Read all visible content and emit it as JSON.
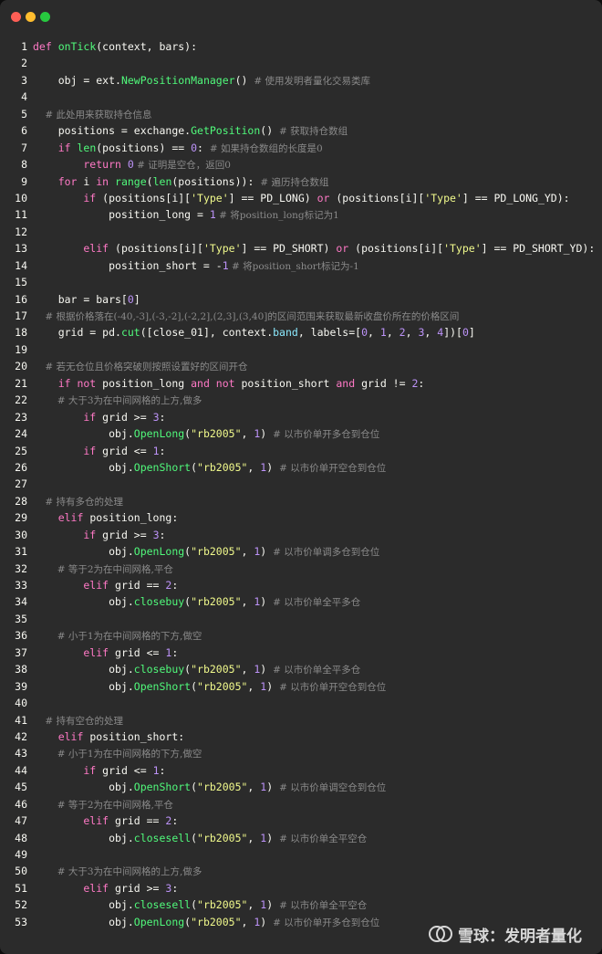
{
  "window": {
    "traffic_lights": [
      "close",
      "minimize",
      "zoom"
    ]
  },
  "code_lines": [
    {
      "n": "1",
      "tokens": [
        [
          "kw",
          "def "
        ],
        [
          "fn",
          "onTick"
        ],
        [
          "",
          "(context, bars):"
        ]
      ]
    },
    {
      "n": "2",
      "tokens": []
    },
    {
      "n": "3",
      "tokens": [
        [
          "",
          "    obj = ext."
        ],
        [
          "fn",
          "NewPositionManager"
        ],
        [
          "",
          "() "
        ],
        [
          "cm",
          "# 使用发明者量化交易类库"
        ]
      ]
    },
    {
      "n": "4",
      "tokens": []
    },
    {
      "n": "5",
      "tokens": [
        [
          "cm",
          "    # 此处用来获取持仓信息"
        ]
      ]
    },
    {
      "n": "6",
      "tokens": [
        [
          "",
          "    positions = exchange."
        ],
        [
          "fn",
          "GetPosition"
        ],
        [
          "",
          "() "
        ],
        [
          "cm",
          "# 获取持仓数组"
        ]
      ]
    },
    {
      "n": "7",
      "tokens": [
        [
          "kw",
          "    if "
        ],
        [
          "fn",
          "len"
        ],
        [
          "",
          "(positions) == "
        ],
        [
          "num",
          "0"
        ],
        [
          "",
          ": "
        ],
        [
          "cm",
          "# 如果持仓数组的长度是0"
        ]
      ]
    },
    {
      "n": "8",
      "tokens": [
        [
          "kw",
          "        return "
        ],
        [
          "num",
          "0"
        ],
        [
          "cm",
          " # 证明是空仓，返回0"
        ]
      ]
    },
    {
      "n": "9",
      "tokens": [
        [
          "kw",
          "    for "
        ],
        [
          "",
          "i "
        ],
        [
          "kw",
          "in "
        ],
        [
          "fn",
          "range"
        ],
        [
          "",
          "("
        ],
        [
          "fn",
          "len"
        ],
        [
          "",
          "(positions)): "
        ],
        [
          "cm",
          "# 遍历持仓数组"
        ]
      ]
    },
    {
      "n": "10",
      "tokens": [
        [
          "kw",
          "        if "
        ],
        [
          "",
          "(positions[i]["
        ],
        [
          "str",
          "'Type'"
        ],
        [
          "",
          "] == PD_LONG) "
        ],
        [
          "kw",
          "or "
        ],
        [
          "",
          "(positions[i]["
        ],
        [
          "str",
          "'Type'"
        ],
        [
          "",
          "] == PD_LONG_YD):"
        ]
      ]
    },
    {
      "n": "11",
      "tokens": [
        [
          "",
          "            position_long = "
        ],
        [
          "num",
          "1"
        ],
        [
          "cm",
          " # 将position_long标记为1"
        ]
      ]
    },
    {
      "n": "12",
      "tokens": []
    },
    {
      "n": "13",
      "tokens": [
        [
          "kw",
          "        elif "
        ],
        [
          "",
          "(positions[i]["
        ],
        [
          "str",
          "'Type'"
        ],
        [
          "",
          "] == PD_SHORT) "
        ],
        [
          "kw",
          "or "
        ],
        [
          "",
          "(positions[i]["
        ],
        [
          "str",
          "'Type'"
        ],
        [
          "",
          "] == PD_SHORT_YD):"
        ]
      ]
    },
    {
      "n": "14",
      "tokens": [
        [
          "",
          "            position_short = -"
        ],
        [
          "num",
          "1"
        ],
        [
          "cm",
          " # 将position_short标记为-1"
        ]
      ]
    },
    {
      "n": "15",
      "tokens": []
    },
    {
      "n": "16",
      "tokens": [
        [
          "",
          "    bar = bars["
        ],
        [
          "num",
          "0"
        ],
        [
          "",
          "]"
        ]
      ]
    },
    {
      "n": "17",
      "tokens": [
        [
          "cm",
          "    # 根据价格落在(-40,-3],(-3,-2],(-2,2],(2,3],(3,40]的区间范围来获取最新收盘价所在的价格区间"
        ]
      ]
    },
    {
      "n": "18",
      "tokens": [
        [
          "",
          "    grid = pd."
        ],
        [
          "fn",
          "cut"
        ],
        [
          "",
          "([close_01], context."
        ],
        [
          "const",
          "band"
        ],
        [
          "",
          ", labels=["
        ],
        [
          "num",
          "0"
        ],
        [
          "",
          ", "
        ],
        [
          "num",
          "1"
        ],
        [
          "",
          ", "
        ],
        [
          "num",
          "2"
        ],
        [
          "",
          ", "
        ],
        [
          "num",
          "3"
        ],
        [
          "",
          ", "
        ],
        [
          "num",
          "4"
        ],
        [
          "",
          "])["
        ],
        [
          "num",
          "0"
        ],
        [
          "",
          "]"
        ]
      ]
    },
    {
      "n": "19",
      "tokens": []
    },
    {
      "n": "20",
      "tokens": [
        [
          "cm",
          "    # 若无仓位且价格突破则按照设置好的区间开仓"
        ]
      ]
    },
    {
      "n": "21",
      "tokens": [
        [
          "kw",
          "    if not "
        ],
        [
          "",
          "position_long "
        ],
        [
          "kw",
          "and not "
        ],
        [
          "",
          "position_short "
        ],
        [
          "kw",
          "and "
        ],
        [
          "",
          "grid != "
        ],
        [
          "num",
          "2"
        ],
        [
          "",
          ":"
        ]
      ]
    },
    {
      "n": "22",
      "tokens": [
        [
          "cm",
          "        # 大于3为在中间网格的上方,做多"
        ]
      ]
    },
    {
      "n": "23",
      "tokens": [
        [
          "kw",
          "        if "
        ],
        [
          "",
          "grid >= "
        ],
        [
          "num",
          "3"
        ],
        [
          "",
          ":"
        ]
      ]
    },
    {
      "n": "24",
      "tokens": [
        [
          "",
          "            obj."
        ],
        [
          "fn",
          "OpenLong"
        ],
        [
          "",
          "("
        ],
        [
          "str",
          "\"rb2005\""
        ],
        [
          "",
          ", "
        ],
        [
          "num",
          "1"
        ],
        [
          "",
          ") "
        ],
        [
          "cm",
          "# 以市价单开多仓到仓位"
        ]
      ]
    },
    {
      "n": "25",
      "tokens": [
        [
          "kw",
          "        if "
        ],
        [
          "",
          "grid <= "
        ],
        [
          "num",
          "1"
        ],
        [
          "",
          ":"
        ]
      ]
    },
    {
      "n": "26",
      "tokens": [
        [
          "",
          "            obj."
        ],
        [
          "fn",
          "OpenShort"
        ],
        [
          "",
          "("
        ],
        [
          "str",
          "\"rb2005\""
        ],
        [
          "",
          ", "
        ],
        [
          "num",
          "1"
        ],
        [
          "",
          ") "
        ],
        [
          "cm",
          "# 以市价单开空仓到仓位"
        ]
      ]
    },
    {
      "n": "27",
      "tokens": []
    },
    {
      "n": "28",
      "tokens": [
        [
          "cm",
          "    # 持有多仓的处理"
        ]
      ]
    },
    {
      "n": "29",
      "tokens": [
        [
          "kw",
          "    elif "
        ],
        [
          "",
          "position_long:"
        ]
      ]
    },
    {
      "n": "30",
      "tokens": [
        [
          "kw",
          "        if "
        ],
        [
          "",
          "grid >= "
        ],
        [
          "num",
          "3"
        ],
        [
          "",
          ":"
        ]
      ]
    },
    {
      "n": "31",
      "tokens": [
        [
          "",
          "            obj."
        ],
        [
          "fn",
          "OpenLong"
        ],
        [
          "",
          "("
        ],
        [
          "str",
          "\"rb2005\""
        ],
        [
          "",
          ", "
        ],
        [
          "num",
          "1"
        ],
        [
          "",
          ") "
        ],
        [
          "cm",
          "# 以市价单调多仓到仓位"
        ]
      ]
    },
    {
      "n": "32",
      "tokens": [
        [
          "cm",
          "        # 等于2为在中间网格,平仓"
        ]
      ]
    },
    {
      "n": "33",
      "tokens": [
        [
          "kw",
          "        elif "
        ],
        [
          "",
          "grid == "
        ],
        [
          "num",
          "2"
        ],
        [
          "",
          ":"
        ]
      ]
    },
    {
      "n": "34",
      "tokens": [
        [
          "",
          "            obj."
        ],
        [
          "fn",
          "closebuy"
        ],
        [
          "",
          "("
        ],
        [
          "str",
          "\"rb2005\""
        ],
        [
          "",
          ", "
        ],
        [
          "num",
          "1"
        ],
        [
          "",
          ") "
        ],
        [
          "cm",
          "# 以市价单全平多仓"
        ]
      ]
    },
    {
      "n": "35",
      "tokens": []
    },
    {
      "n": "36",
      "tokens": [
        [
          "cm",
          "        # 小于1为在中间网格的下方,做空"
        ]
      ]
    },
    {
      "n": "37",
      "tokens": [
        [
          "kw",
          "        elif "
        ],
        [
          "",
          "grid <= "
        ],
        [
          "num",
          "1"
        ],
        [
          "",
          ":"
        ]
      ]
    },
    {
      "n": "38",
      "tokens": [
        [
          "",
          "            obj."
        ],
        [
          "fn",
          "closebuy"
        ],
        [
          "",
          "("
        ],
        [
          "str",
          "\"rb2005\""
        ],
        [
          "",
          ", "
        ],
        [
          "num",
          "1"
        ],
        [
          "",
          ") "
        ],
        [
          "cm",
          "# 以市价单全平多仓"
        ]
      ]
    },
    {
      "n": "39",
      "tokens": [
        [
          "",
          "            obj."
        ],
        [
          "fn",
          "OpenShort"
        ],
        [
          "",
          "("
        ],
        [
          "str",
          "\"rb2005\""
        ],
        [
          "",
          ", "
        ],
        [
          "num",
          "1"
        ],
        [
          "",
          ") "
        ],
        [
          "cm",
          "# 以市价单开空仓到仓位"
        ]
      ]
    },
    {
      "n": "40",
      "tokens": []
    },
    {
      "n": "41",
      "tokens": [
        [
          "cm",
          "    # 持有空仓的处理"
        ]
      ]
    },
    {
      "n": "42",
      "tokens": [
        [
          "kw",
          "    elif "
        ],
        [
          "",
          "position_short:"
        ]
      ]
    },
    {
      "n": "43",
      "tokens": [
        [
          "cm",
          "        # 小于1为在中间网格的下方,做空"
        ]
      ]
    },
    {
      "n": "44",
      "tokens": [
        [
          "kw",
          "        if "
        ],
        [
          "",
          "grid <= "
        ],
        [
          "num",
          "1"
        ],
        [
          "",
          ":"
        ]
      ]
    },
    {
      "n": "45",
      "tokens": [
        [
          "",
          "            obj."
        ],
        [
          "fn",
          "OpenShort"
        ],
        [
          "",
          "("
        ],
        [
          "str",
          "\"rb2005\""
        ],
        [
          "",
          ", "
        ],
        [
          "num",
          "1"
        ],
        [
          "",
          ") "
        ],
        [
          "cm",
          "# 以市价单调空仓到仓位"
        ]
      ]
    },
    {
      "n": "46",
      "tokens": [
        [
          "cm",
          "        # 等于2为在中间网格,平仓"
        ]
      ]
    },
    {
      "n": "47",
      "tokens": [
        [
          "kw",
          "        elif "
        ],
        [
          "",
          "grid == "
        ],
        [
          "num",
          "2"
        ],
        [
          "",
          ":"
        ]
      ]
    },
    {
      "n": "48",
      "tokens": [
        [
          "",
          "            obj."
        ],
        [
          "fn",
          "closesell"
        ],
        [
          "",
          "("
        ],
        [
          "str",
          "\"rb2005\""
        ],
        [
          "",
          ", "
        ],
        [
          "num",
          "1"
        ],
        [
          "",
          ") "
        ],
        [
          "cm",
          "# 以市价单全平空仓"
        ]
      ]
    },
    {
      "n": "49",
      "tokens": []
    },
    {
      "n": "50",
      "tokens": [
        [
          "cm",
          "        # 大于3为在中间网格的上方,做多"
        ]
      ]
    },
    {
      "n": "51",
      "tokens": [
        [
          "kw",
          "        elif "
        ],
        [
          "",
          "grid >= "
        ],
        [
          "num",
          "3"
        ],
        [
          "",
          ":"
        ]
      ]
    },
    {
      "n": "52",
      "tokens": [
        [
          "",
          "            obj."
        ],
        [
          "fn",
          "closesell"
        ],
        [
          "",
          "("
        ],
        [
          "str",
          "\"rb2005\""
        ],
        [
          "",
          ", "
        ],
        [
          "num",
          "1"
        ],
        [
          "",
          ") "
        ],
        [
          "cm",
          "# 以市价单全平空仓"
        ]
      ]
    },
    {
      "n": "53",
      "tokens": [
        [
          "",
          "            obj."
        ],
        [
          "fn",
          "OpenLong"
        ],
        [
          "",
          "("
        ],
        [
          "str",
          "\"rb2005\""
        ],
        [
          "",
          ", "
        ],
        [
          "num",
          "1"
        ],
        [
          "",
          ") "
        ],
        [
          "cm",
          "# 以市价单开多仓到仓位"
        ]
      ]
    }
  ],
  "watermark": {
    "text": "雪球：发明者量化",
    "icon": "xueqiu-logo-icon"
  },
  "colors": {
    "background": "#2b2b2b",
    "keyword": "#ff79c6",
    "function": "#50fa7b",
    "string": "#f1fa8c",
    "number": "#bd93f9",
    "comment": "#8a8a8a"
  }
}
